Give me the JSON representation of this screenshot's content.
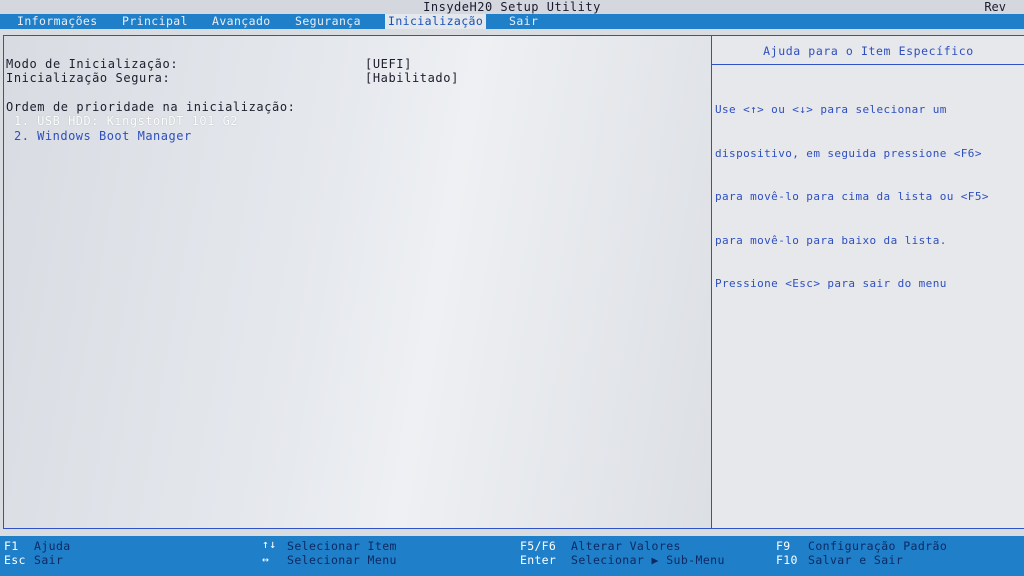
{
  "window": {
    "title": "InsydeH20 Setup Utility",
    "rev": "Rev"
  },
  "tabs": [
    {
      "label": "Informações"
    },
    {
      "label": "Principal"
    },
    {
      "label": "Avançado"
    },
    {
      "label": "Segurança"
    },
    {
      "label": "Inicialização",
      "active": true
    },
    {
      "label": "Sair"
    }
  ],
  "settings": {
    "boot_mode": {
      "label": "Modo de Inicialização:",
      "value": "[UEFI]"
    },
    "secure_boot": {
      "label": "Inicialização Segura:",
      "value": "[Habilitado]"
    }
  },
  "boot_order": {
    "title": "Ordem de prioridade na inicialização:",
    "items": [
      {
        "label": "1. USB HDD: KingstonDT 101 G2",
        "selected": true
      },
      {
        "label": "2. Windows Boot Manager",
        "selected": false
      }
    ]
  },
  "help": {
    "title": "Ajuda para o Item Específico",
    "lines": [
      "Use <↑> ou <↓> para selecionar um",
      "dispositivo, em seguida pressione <F6>",
      "para movê-lo para cima da lista ou <F5>",
      "para movê-lo para baixo da lista.",
      "Pressione <Esc> para sair do menu"
    ]
  },
  "footer": {
    "f1_key": "F1",
    "f1_desc": "Ajuda",
    "esc_key": "Esc",
    "esc_desc": "Sair",
    "updown_key": "↑↓",
    "updown_desc": "Selecionar Item",
    "leftright_key": "↔",
    "leftright_desc": "Selecionar Menu",
    "f5f6_key": "F5/F6",
    "f5f6_desc": "Alterar Valores",
    "enter_key": "Enter",
    "enter_desc": "Selecionar ▶ Sub-Menu",
    "f9_key": "F9",
    "f9_desc": "Configuração Padrão",
    "f10_key": "F10",
    "f10_desc": "Salvar e Sair"
  },
  "colors": {
    "menubar": "#1f7fc8",
    "active_tab_text": "#1750b8",
    "panel_border": "#2f52c8",
    "help_text": "#2e4fbe"
  }
}
